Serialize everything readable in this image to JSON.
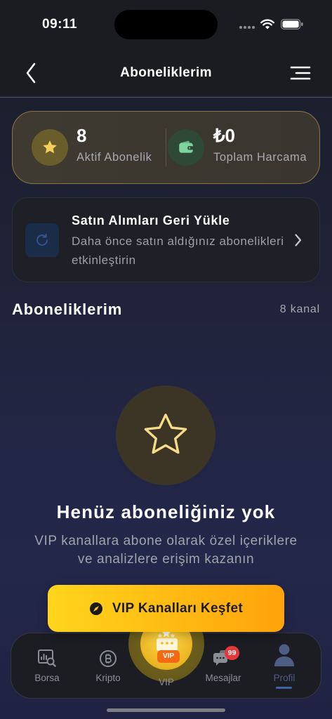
{
  "status_bar": {
    "time": "09:11"
  },
  "header": {
    "title": "Aboneliklerim",
    "back_icon": "chevron-left-icon",
    "menu_icon": "menu-lines-icon"
  },
  "stats": {
    "active": {
      "value": "8",
      "label": "Aktif Abonelik",
      "icon": "star-icon"
    },
    "spending": {
      "value": "₺0",
      "label": "Toplam Harcama",
      "icon": "wallet-icon"
    }
  },
  "restore": {
    "title": "Satın Alımları Geri Yükle",
    "description": [
      "Daha önce satın aldığınız abonelikleri",
      "etkinleştirin"
    ],
    "icon": "refresh-icon"
  },
  "subscriptions": {
    "title": "Aboneliklerim",
    "count": "8 kanal"
  },
  "empty_state": {
    "title": "Henüz aboneliğiniz yok",
    "message": [
      "VIP kanallara abone olarak özel içeriklere",
      "ve analizlere erişim kazanın"
    ],
    "icon": "star-outline-icon"
  },
  "cta": {
    "label": "VIP Kanalları Keşfet",
    "icon": "compass-icon"
  },
  "tab_bar": {
    "tabs": [
      {
        "label": "Borsa",
        "icon": "chart-search-icon",
        "active": false
      },
      {
        "label": "Kripto",
        "icon": "bitcoin-icon",
        "active": false
      },
      {
        "label": "VIP",
        "icon": "vip-crown-icon",
        "active": false,
        "badge": "VIP"
      },
      {
        "label": "Mesajlar",
        "icon": "chat-bubbles-icon",
        "active": false,
        "badge": "99"
      },
      {
        "label": "Profil",
        "icon": "person-icon",
        "active": true
      }
    ]
  },
  "theme": {
    "background": "#1e2136",
    "accent_gold": "#f3cf5c",
    "card_border_gold": "#8a7844",
    "cta_gradient_start": "#ffd51c",
    "cta_gradient_end": "#ffa30b",
    "active_tab": "#4d5d84",
    "badge_red": "#e5383b",
    "vip_badge_orange": "#f36a14"
  }
}
